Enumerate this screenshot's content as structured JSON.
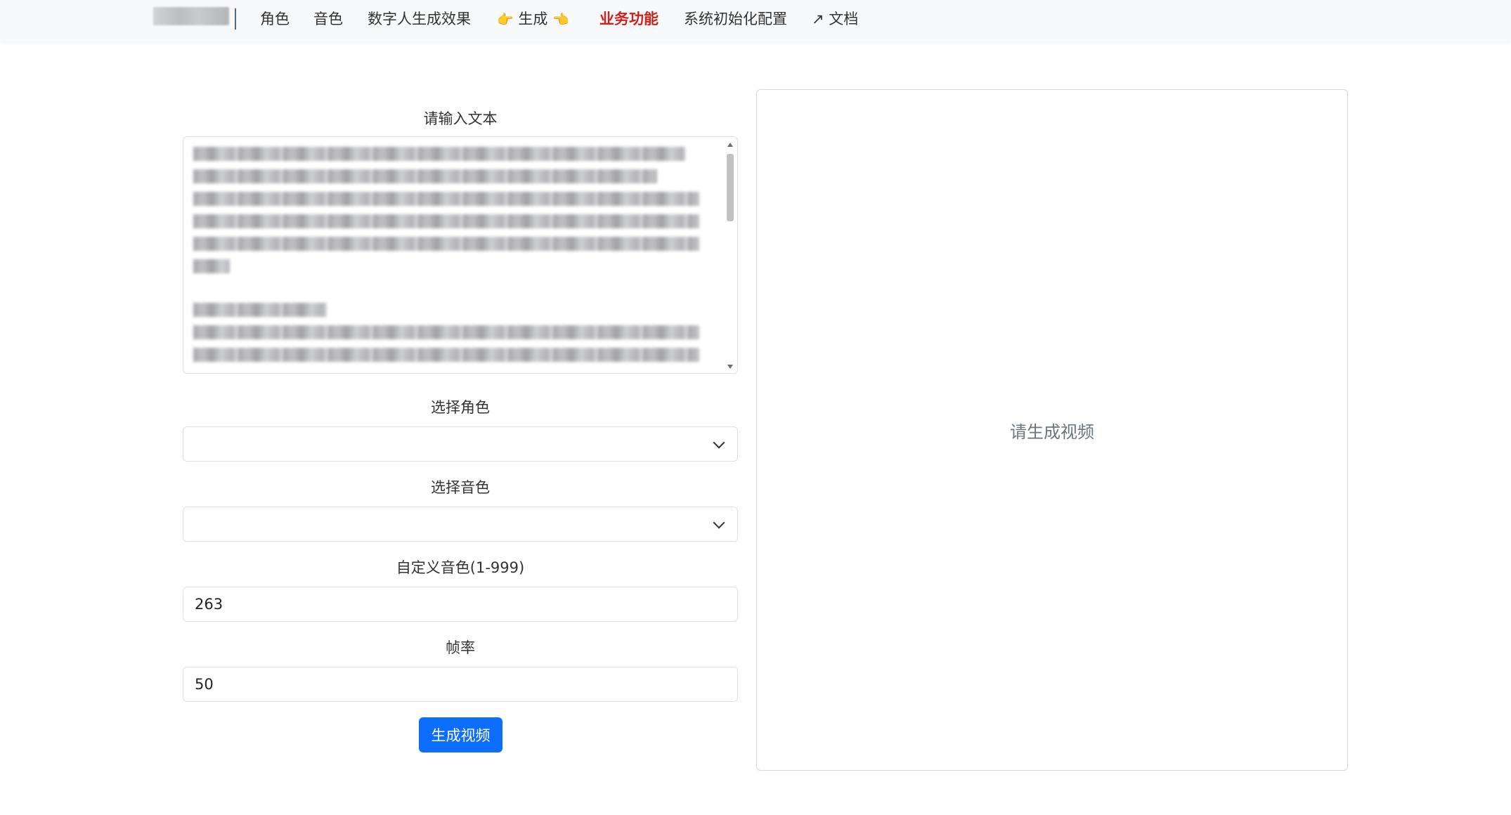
{
  "nav": {
    "items": [
      {
        "label": "角色"
      },
      {
        "label": "音色"
      },
      {
        "label": "数字人生成效果"
      },
      {
        "label": "生成",
        "emoji_left": "👉",
        "emoji_right": "👈"
      },
      {
        "label": "业务功能"
      },
      {
        "label": "系统初始化配置"
      },
      {
        "label": "文档",
        "prefix": "↗"
      }
    ],
    "active_color": "#d0211c"
  },
  "form": {
    "text_label": "请输入文本",
    "role_label": "选择角色",
    "role_value": "",
    "voice_label": "选择音色",
    "voice_value": "",
    "custom_voice_label": "自定义音色(1-999)",
    "custom_voice_value": "263",
    "fps_label": "帧率",
    "fps_value": "50",
    "submit_label": "生成视频"
  },
  "preview": {
    "placeholder": "请生成视频"
  },
  "colors": {
    "primary": "#0d6efd",
    "nav_bg": "#f8f9fa",
    "active": "#d0211c"
  },
  "icons": {
    "brand": "brand-logo-blurred",
    "select": "chevron-down-icon",
    "external": "external-link-icon"
  }
}
